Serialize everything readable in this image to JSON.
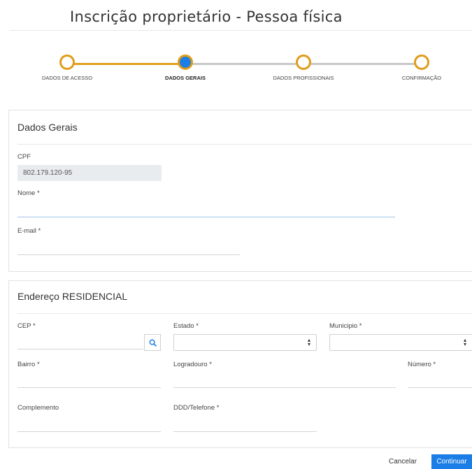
{
  "page": {
    "title": "Inscrição proprietário - Pessoa física"
  },
  "stepper": {
    "steps": [
      {
        "label": "DADOS DE ACESSO",
        "state": "done"
      },
      {
        "label": "DADOS GERAIS",
        "state": "active"
      },
      {
        "label": "DADOS PROFISSIONAIS",
        "state": "todo"
      },
      {
        "label": "CONFIRMAÇÃO",
        "state": "todo"
      }
    ],
    "colors": {
      "done": "#e09c1a",
      "active": "#1a7ee6",
      "todo": "#c8c8c8"
    }
  },
  "dados_gerais": {
    "title": "Dados Gerais",
    "cpf": {
      "label": "CPF",
      "value": "802.179.120-95"
    },
    "nome": {
      "label": "Nome *",
      "value": ""
    },
    "email": {
      "label": "E-mail *",
      "value": ""
    }
  },
  "endereco": {
    "title": "Endereço RESIDENCIAL",
    "cep": {
      "label": "CEP *",
      "value": "",
      "icon": "search-icon"
    },
    "estado": {
      "label": "Estado *",
      "selected": ""
    },
    "municipio": {
      "label": "Municipio *",
      "selected": ""
    },
    "bairro": {
      "label": "Bairro *",
      "value": ""
    },
    "logradouro": {
      "label": "Logradouro *",
      "value": ""
    },
    "numero": {
      "label": "Número *",
      "value": ""
    },
    "complemento": {
      "label": "Complemento",
      "value": ""
    },
    "telefone": {
      "label": "DDD/Telefone *",
      "value": ""
    }
  },
  "actions": {
    "cancel": "Cancelar",
    "continue": "Continuar"
  }
}
